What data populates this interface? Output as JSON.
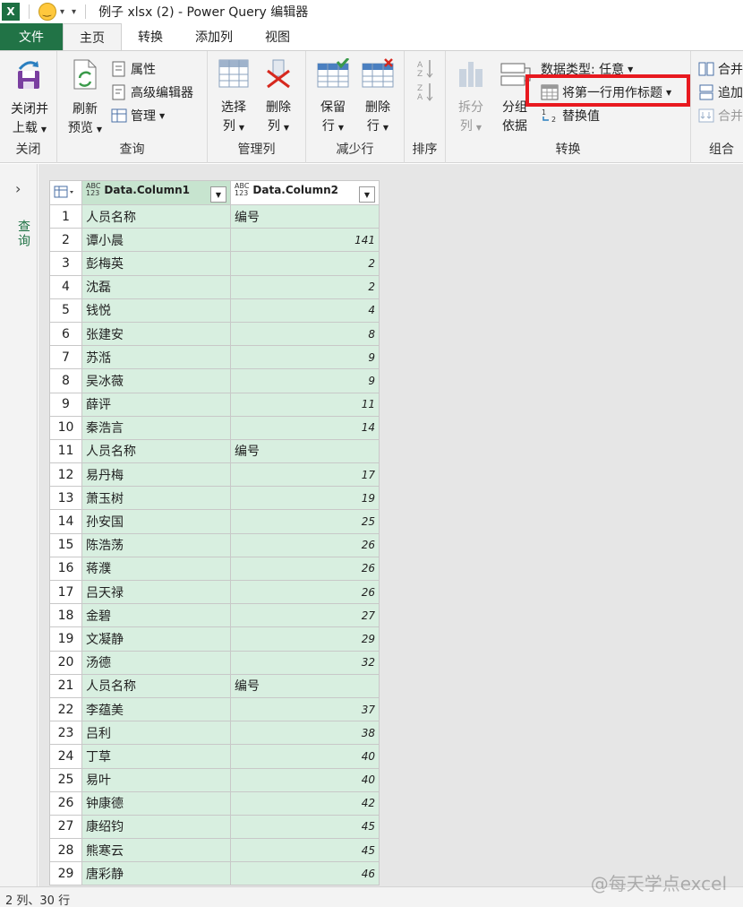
{
  "titlebar": {
    "app_icon": "X",
    "title": "例子 xlsx (2) - Power Query 编辑器"
  },
  "tabs": [
    {
      "label": "文件"
    },
    {
      "label": "主页"
    },
    {
      "label": "转换"
    },
    {
      "label": "添加列"
    },
    {
      "label": "视图"
    }
  ],
  "ribbon": {
    "close_group": {
      "btn_line1": "关闭并",
      "btn_line2": "上载",
      "label": "关闭"
    },
    "query_group": {
      "refresh_line1": "刷新",
      "refresh_line2": "预览",
      "properties": "属性",
      "advanced_editor": "高级编辑器",
      "manage": "管理",
      "label": "查询"
    },
    "manage_cols_group": {
      "choose_line1": "选择",
      "choose_line2": "列",
      "remove_line1": "删除",
      "remove_line2": "列",
      "label": "管理列"
    },
    "reduce_rows_group": {
      "keep_line1": "保留",
      "keep_line2": "行",
      "remove_line1": "删除",
      "remove_line2": "行",
      "label": "减少行"
    },
    "sort_group": {
      "label": "排序"
    },
    "transform_group": {
      "split_line1": "拆分",
      "split_line2": "列",
      "groupby_line1": "分组",
      "groupby_line2": "依据",
      "data_type": "数据类型: 任意",
      "use_first_row": "将第一行用作标题",
      "replace_values": "替换值",
      "label": "转换"
    },
    "combine_group": {
      "merge": "合并",
      "append": "追加",
      "combine_files": "合并",
      "label": "组合"
    }
  },
  "query_pane": {
    "label": "查询"
  },
  "grid": {
    "columns": [
      {
        "type_top": "ABC",
        "type_bottom": "123",
        "name": "Data.Column1"
      },
      {
        "type_top": "ABC",
        "type_bottom": "123",
        "name": "Data.Column2"
      }
    ],
    "rows": [
      {
        "n": "1",
        "c1": "人员名称",
        "c2": "编号"
      },
      {
        "n": "2",
        "c1": "谭小晨",
        "c2": "141"
      },
      {
        "n": "3",
        "c1": "彭梅英",
        "c2": "2"
      },
      {
        "n": "4",
        "c1": "沈磊",
        "c2": "2"
      },
      {
        "n": "5",
        "c1": "钱悦",
        "c2": "4"
      },
      {
        "n": "6",
        "c1": "张建安",
        "c2": "8"
      },
      {
        "n": "7",
        "c1": "苏湉",
        "c2": "9"
      },
      {
        "n": "8",
        "c1": "吴冰薇",
        "c2": "9"
      },
      {
        "n": "9",
        "c1": "薛评",
        "c2": "11"
      },
      {
        "n": "10",
        "c1": "秦浩言",
        "c2": "14"
      },
      {
        "n": "11",
        "c1": "人员名称",
        "c2": "编号"
      },
      {
        "n": "12",
        "c1": "易丹梅",
        "c2": "17"
      },
      {
        "n": "13",
        "c1": "萧玉树",
        "c2": "19"
      },
      {
        "n": "14",
        "c1": "孙安国",
        "c2": "25"
      },
      {
        "n": "15",
        "c1": "陈浩荡",
        "c2": "26"
      },
      {
        "n": "16",
        "c1": "蒋濮",
        "c2": "26"
      },
      {
        "n": "17",
        "c1": "吕天禄",
        "c2": "26"
      },
      {
        "n": "18",
        "c1": "金碧",
        "c2": "27"
      },
      {
        "n": "19",
        "c1": "文凝静",
        "c2": "29"
      },
      {
        "n": "20",
        "c1": "汤德",
        "c2": "32"
      },
      {
        "n": "21",
        "c1": "人员名称",
        "c2": "编号"
      },
      {
        "n": "22",
        "c1": "李蕴美",
        "c2": "37"
      },
      {
        "n": "23",
        "c1": "吕利",
        "c2": "38"
      },
      {
        "n": "24",
        "c1": "丁草",
        "c2": "40"
      },
      {
        "n": "25",
        "c1": "易叶",
        "c2": "40"
      },
      {
        "n": "26",
        "c1": "钟康德",
        "c2": "42"
      },
      {
        "n": "27",
        "c1": "康绍钧",
        "c2": "45"
      },
      {
        "n": "28",
        "c1": "熊寒云",
        "c2": "45"
      },
      {
        "n": "29",
        "c1": "唐彩静",
        "c2": "46"
      }
    ]
  },
  "status": {
    "text": "2 列、30 行"
  },
  "watermark": {
    "text": "@每天学点excel"
  },
  "colors": {
    "accent": "#217346",
    "highlight": "#e8191f",
    "cell_bg": "#d8efe0"
  }
}
